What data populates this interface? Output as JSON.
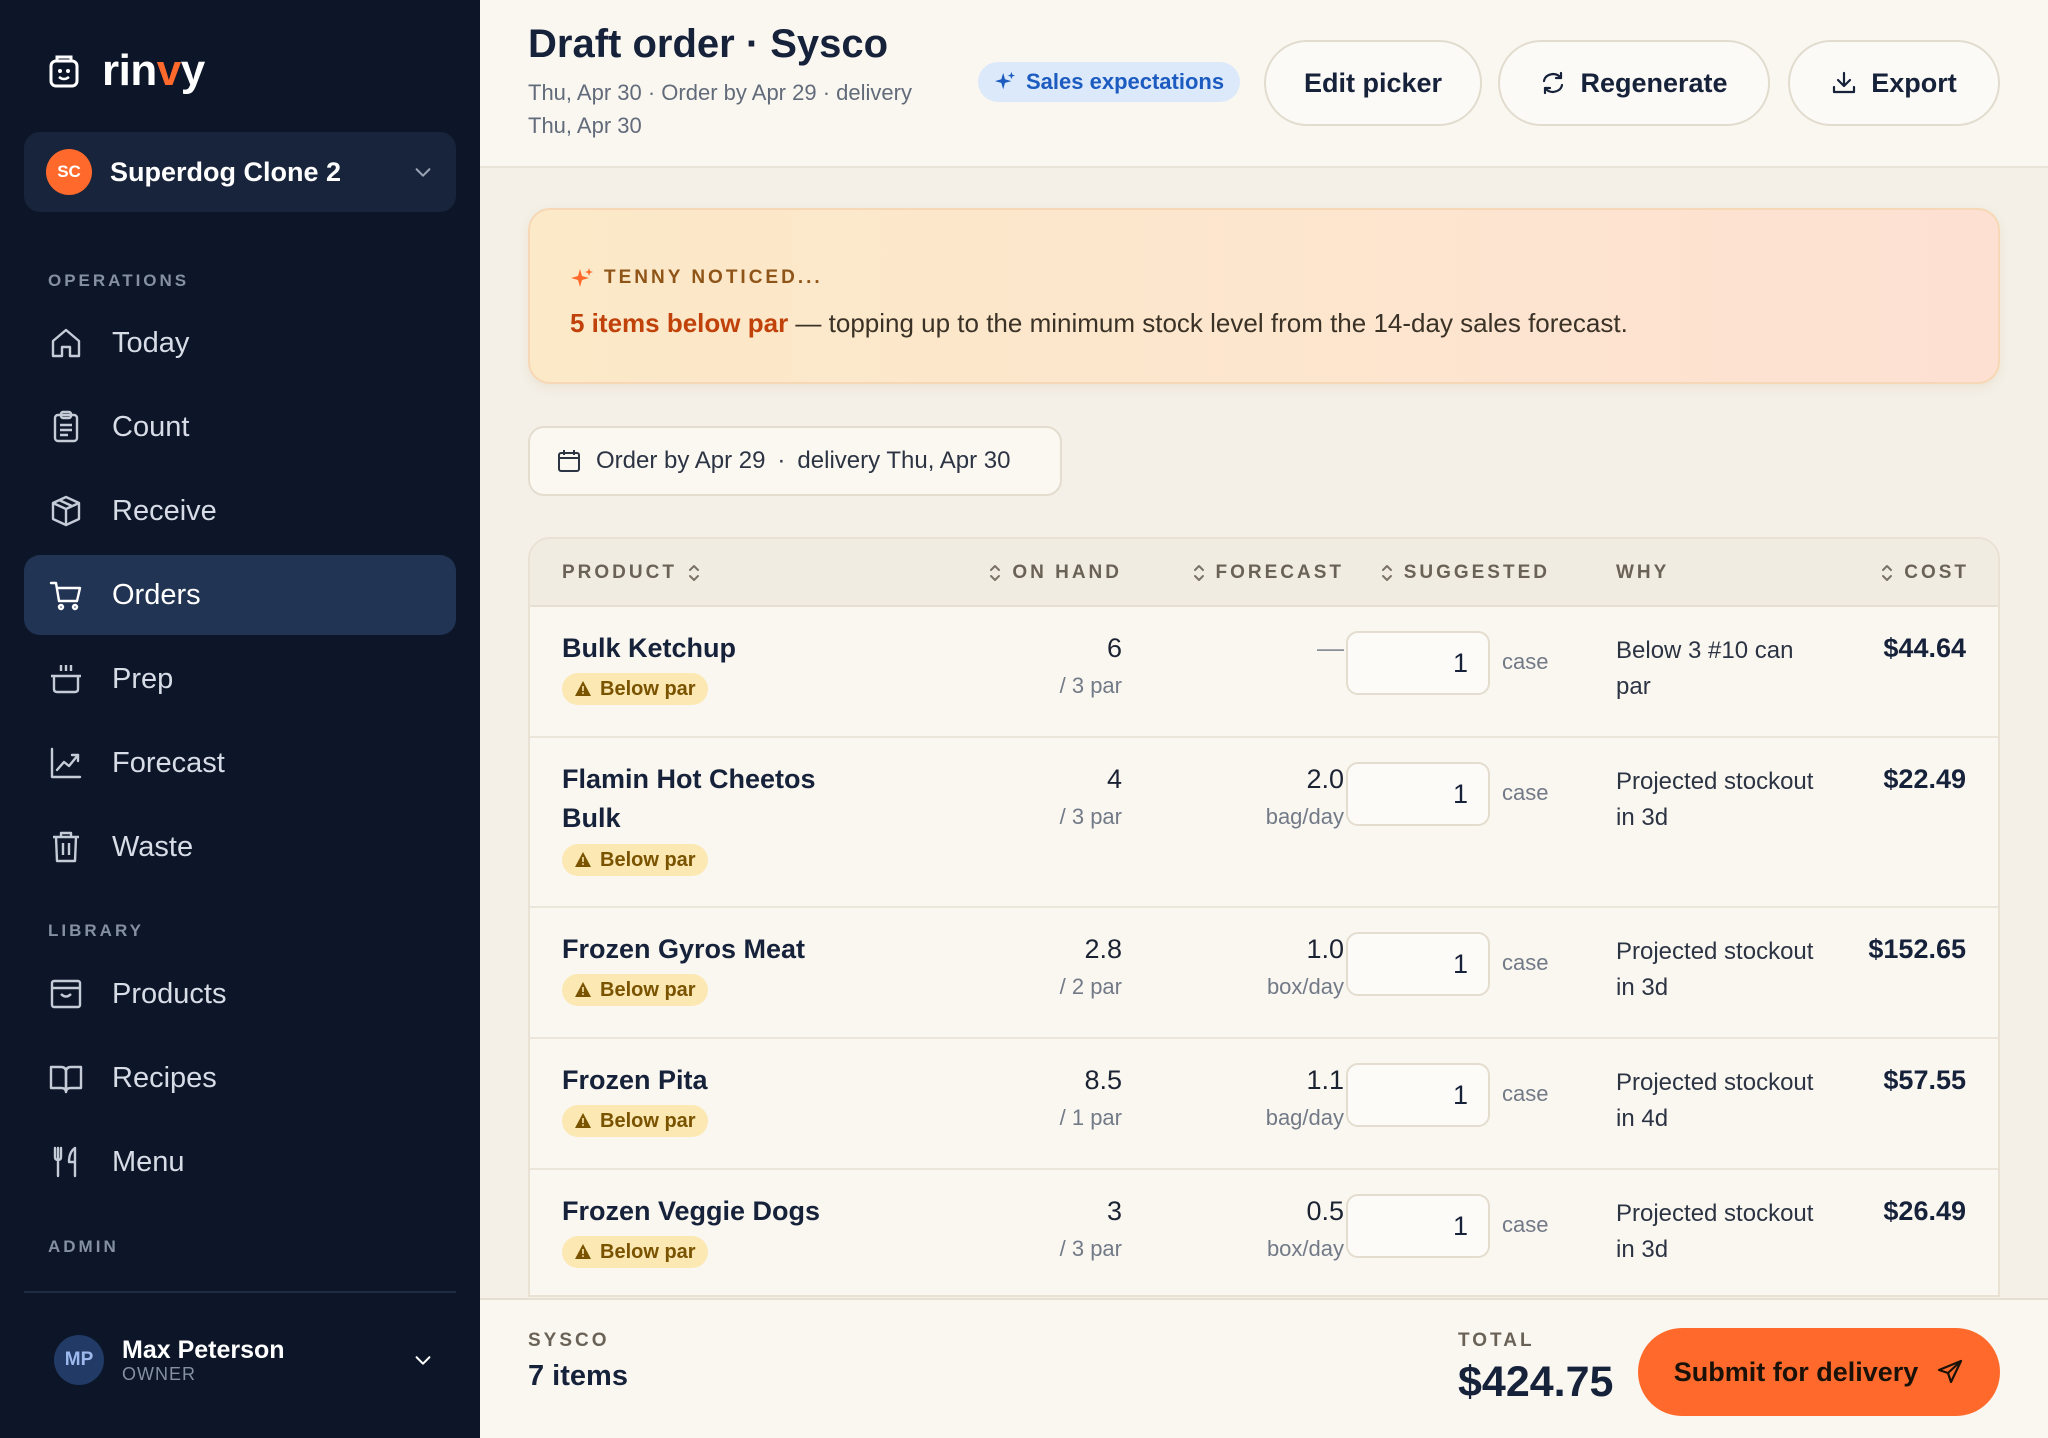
{
  "brand": {
    "name_pre": "rin",
    "name_accent": "v",
    "name_post": "y",
    "accent_color": "#ff6a2c"
  },
  "workspace": {
    "initials": "SC",
    "name": "Superdog Clone 2"
  },
  "sidebar": {
    "sections": [
      "OPERATIONS",
      "LIBRARY",
      "ADMIN"
    ],
    "operations": [
      {
        "label": "Today",
        "icon": "home-icon"
      },
      {
        "label": "Count",
        "icon": "clipboard-icon"
      },
      {
        "label": "Receive",
        "icon": "box-icon"
      },
      {
        "label": "Orders",
        "icon": "cart-icon",
        "active": true
      },
      {
        "label": "Prep",
        "icon": "pot-icon"
      },
      {
        "label": "Forecast",
        "icon": "chart-icon"
      },
      {
        "label": "Waste",
        "icon": "trash-icon"
      }
    ],
    "library": [
      {
        "label": "Products",
        "icon": "archive-icon"
      },
      {
        "label": "Recipes",
        "icon": "book-icon"
      },
      {
        "label": "Menu",
        "icon": "utensils-icon"
      }
    ]
  },
  "user": {
    "initials": "MP",
    "name": "Max Peterson",
    "role": "OWNER"
  },
  "header": {
    "title": "Draft order · Sysco",
    "subtitle": "Thu, Apr 30 · Order by Apr 29 · delivery Thu, Apr 30",
    "pill": "Sales expectations",
    "buttons": {
      "edit": "Edit picker",
      "regenerate": "Regenerate",
      "export": "Export"
    }
  },
  "banner": {
    "tag": "TENNY NOTICED...",
    "highlight": "5 items below par",
    "text": " — topping up to the minimum stock level from the 14-day sales forecast."
  },
  "date_chip": {
    "order_by": "Order by Apr 29",
    "separator": "·",
    "delivery": "delivery Thu, Apr 30"
  },
  "table": {
    "columns": {
      "product": "PRODUCT",
      "on_hand": "ON HAND",
      "forecast": "FORECAST",
      "suggested": "SUGGESTED",
      "why": "WHY",
      "cost": "COST"
    },
    "badge_label": "Below par",
    "rows": [
      {
        "name": "Bulk Ketchup",
        "on_hand": "6",
        "par": "/ 3 par",
        "forecast": "—",
        "forecast_unit": "",
        "qty": "1",
        "unit": "case",
        "why": "Below 3 #10 can par",
        "cost": "$44.64"
      },
      {
        "name": "Flamin Hot Cheetos Bulk",
        "on_hand": "4",
        "par": "/ 3 par",
        "forecast": "2.0",
        "forecast_unit": "bag/day",
        "qty": "1",
        "unit": "case",
        "why": "Projected stockout in 3d",
        "cost": "$22.49"
      },
      {
        "name": "Frozen Gyros Meat",
        "on_hand": "2.8",
        "par": "/ 2 par",
        "forecast": "1.0",
        "forecast_unit": "box/day",
        "qty": "1",
        "unit": "case",
        "why": "Projected stockout in 3d",
        "cost": "$152.65"
      },
      {
        "name": "Frozen Pita",
        "on_hand": "8.5",
        "par": "/ 1 par",
        "forecast": "1.1",
        "forecast_unit": "bag/day",
        "qty": "1",
        "unit": "case",
        "why": "Projected stockout in 4d",
        "cost": "$57.55"
      },
      {
        "name": "Frozen Veggie Dogs",
        "on_hand": "3",
        "par": "/ 3 par",
        "forecast": "0.5",
        "forecast_unit": "box/day",
        "qty": "1",
        "unit": "case",
        "why": "Projected stockout in 3d",
        "cost": "$26.49"
      }
    ]
  },
  "footer": {
    "vendor": "SYSCO",
    "items": "7 items",
    "total_label": "TOTAL",
    "total": "$424.75",
    "submit": "Submit for delivery"
  }
}
